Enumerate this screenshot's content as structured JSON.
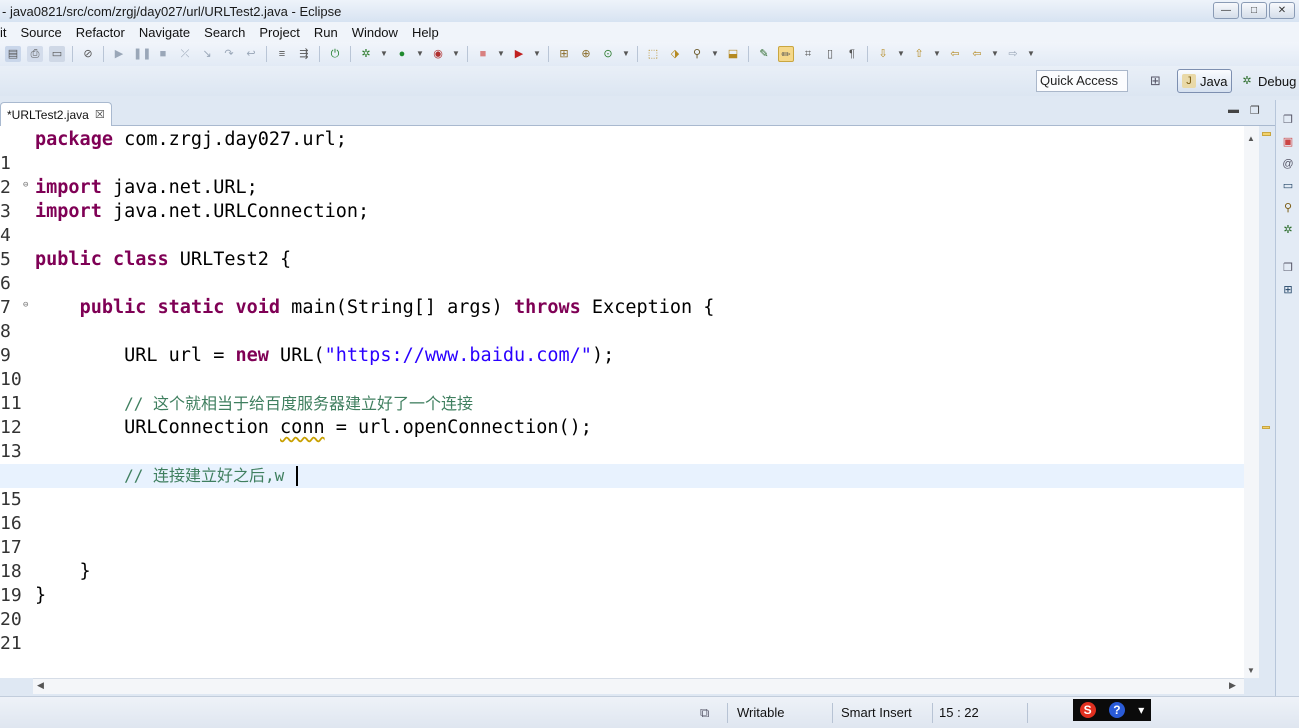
{
  "window": {
    "title": "- java0821/src/com/zrgj/day027/url/URLTest2.java - Eclipse",
    "min_label": "—",
    "max_label": "□",
    "close_label": "✕"
  },
  "menu": [
    "it",
    "Source",
    "Refactor",
    "Navigate",
    "Search",
    "Project",
    "Run",
    "Window",
    "Help"
  ],
  "perspective": {
    "quick_access": "Quick Access",
    "java_label": "Java",
    "debug_label": "Debug"
  },
  "editor": {
    "tab_label": "*URLTest2.java",
    "tab_close": "☒",
    "line_numbers": [
      "1",
      "2",
      "3",
      "4",
      "5",
      "6",
      "7",
      "8",
      "9",
      "10",
      "11",
      "12",
      "13",
      "14",
      "15",
      "16",
      "17",
      "18",
      "19",
      "20",
      "21"
    ],
    "lines": {
      "l1_kw": "package",
      "l1_rest": " com.zrgj.day027.url;",
      "l3_kw": "import",
      "l3_rest": " java.net.URL;",
      "l4_kw": "import",
      "l4_rest": " java.net.URLConnection;",
      "l6_kw": "public class",
      "l6_rest": " URLTest2 {",
      "l8_indent": "    ",
      "l8_kw": "public static void",
      "l8_mid": " main(String[] args) ",
      "l8_kw2": "throws",
      "l8_rest": " Exception {",
      "l10_indent": "        ",
      "l10_pre": "URL url = ",
      "l10_kw": "new",
      "l10_mid": " URL(",
      "l10_str": "\"https://www.baidu.com/\"",
      "l10_rest": ");",
      "l12_indent": "        ",
      "l12_cmt": "// 这个就相当于给百度服务器建立好了一个连接",
      "l13_indent": "        ",
      "l13_pre": "URLConnection ",
      "l13_warn": "conn",
      "l13_rest": " = url.openConnection();",
      "l15_indent": "        ",
      "l15_cmt": "// 连接建立好之后,w ",
      "l19_text": "    }",
      "l20_text": "}"
    }
  },
  "status": {
    "writable": "Writable",
    "insert_mode": "Smart Insert",
    "position": "15 : 22"
  },
  "tray": {
    "s_label": "S",
    "help_label": "?",
    "arrow_label": "▾"
  },
  "colors": {
    "keyword": "#7f0055",
    "string": "#2a00ff",
    "comment": "#3f7f5f",
    "current_line": "#e8f2fe"
  }
}
